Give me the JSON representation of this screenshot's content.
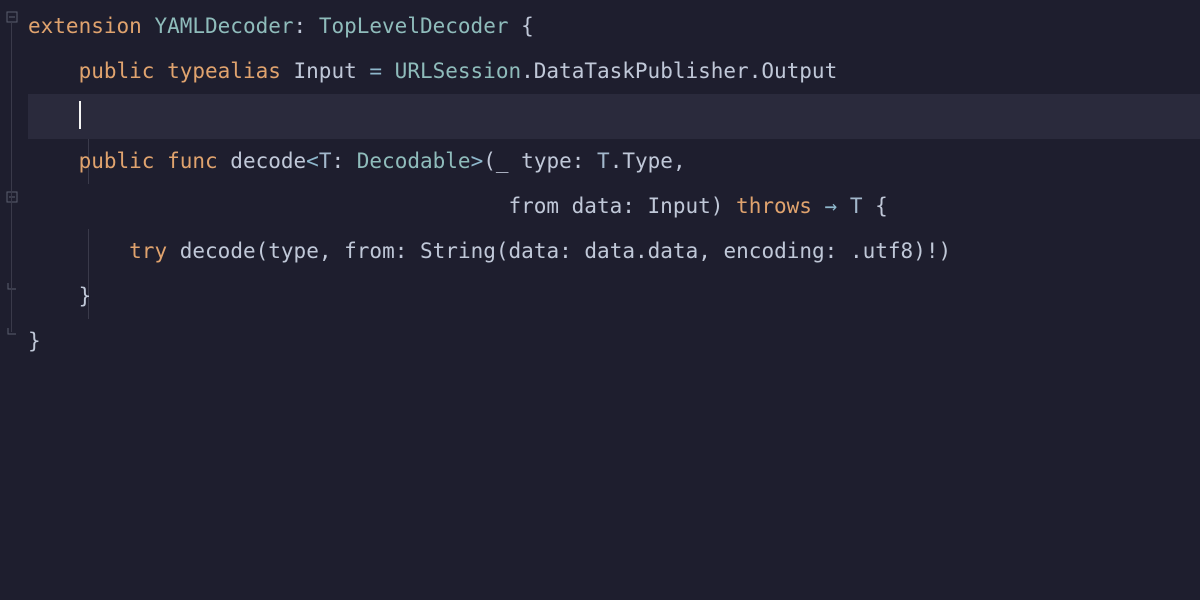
{
  "editor": {
    "line_height_px": 45,
    "cursor_line_index": 2,
    "cursor_col": 4
  },
  "tokens": {
    "l1": {
      "extension": "extension",
      "type1": "YAMLDecoder",
      "colon": ": ",
      "type2": "TopLevelDecoder",
      "brace": " {"
    },
    "l2": {
      "indent": "    ",
      "public": "public",
      "typealias": " typealias ",
      "input": "Input",
      "eq": " = ",
      "urlsession": "URLSession",
      "dot1": ".",
      "dtp": "DataTaskPublisher",
      "dot2": ".",
      "output": "Output"
    },
    "l3": {
      "indent": "    "
    },
    "l4": {
      "indent": "    ",
      "public": "public",
      "func": " func ",
      "name": "decode",
      "generic_open": "<",
      "generic_t": "T",
      "generic_colon": ": ",
      "decodable": "Decodable",
      "generic_close": ">",
      "paren_open": "(",
      "underscore": "_ ",
      "param_t": "type",
      "param_colon": ": ",
      "t_type": "T",
      "dot": ".",
      "type_word": "Type",
      "comma": ","
    },
    "l5": {
      "indent": "                                      ",
      "from": "from ",
      "data": "data",
      "colon": ": ",
      "input": "Input",
      "paren_close": ") ",
      "throws": "throws",
      "arrow": " → ",
      "ret": "T",
      "brace": " {"
    },
    "l6": {
      "indent": "        ",
      "try": "try",
      "sp": " ",
      "decode": "decode",
      "open": "(",
      "type_arg": "type",
      "comma": ", ",
      "from": "from",
      "colon1": ": ",
      "string": "String",
      "open2": "(",
      "data_lbl": "data",
      "colon2": ": ",
      "data_arg": "data",
      "dot": ".",
      "data_prop": "data",
      "comma2": ", ",
      "encoding": "encoding",
      "colon3": ": ",
      "dot2": ".",
      "utf8": "utf8",
      "close2": ")",
      "bang": "!",
      "close": ")"
    },
    "l7": {
      "indent": "    ",
      "brace": "}"
    },
    "l8": {
      "brace": "}"
    }
  },
  "fold_markers": [
    {
      "line": 0,
      "kind": "minus"
    },
    {
      "line": 4,
      "kind": "minus"
    },
    {
      "line": 6,
      "kind": "end"
    },
    {
      "line": 7,
      "kind": "end"
    }
  ]
}
